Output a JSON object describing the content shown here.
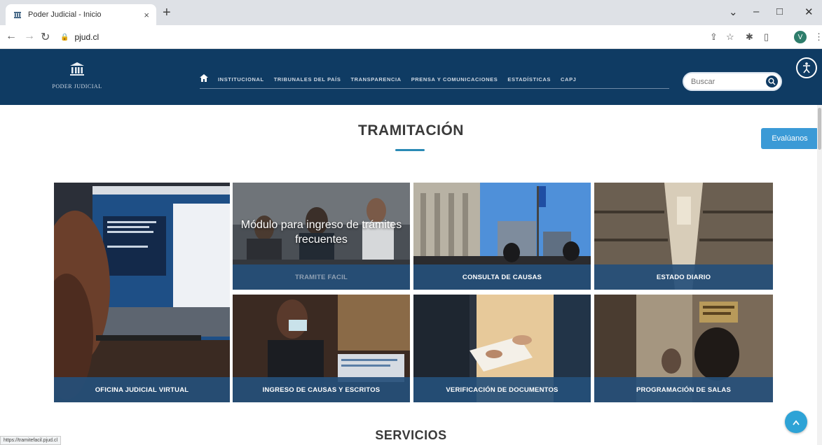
{
  "browser": {
    "tab_title": "Poder Judicial - Inicio",
    "tab_close": "×",
    "new_tab": "+",
    "window_controls": {
      "dropdown": "⌄",
      "minimize": "–",
      "maximize": "□",
      "close": "✕"
    },
    "url": "pjud.cl",
    "profile_initial": "V",
    "status_url": "https://tramitefacil.pjud.cl"
  },
  "header": {
    "logo_text": "PODER JUDICIAL",
    "nav_items": [
      "INSTITUCIONAL",
      "TRIBUNALES DEL PAÍS",
      "TRANSPARENCIA",
      "PRENSA Y COMUNICACIONES",
      "ESTADÍSTICAS",
      "CAPJ"
    ],
    "search_placeholder": "Buscar"
  },
  "main": {
    "section_title": "TRAMITACIÓN",
    "evaluanos_label": "Evalúanos",
    "tiles": [
      {
        "caption": "OFICINA JUDICIAL VIRTUAL",
        "overlay": ""
      },
      {
        "caption": "TRAMITE FACIL",
        "overlay": "Módulo para ingreso de trámites frecuentes"
      },
      {
        "caption": "CONSULTA DE CAUSAS",
        "overlay": ""
      },
      {
        "caption": "ESTADO DIARIO",
        "overlay": ""
      },
      {
        "caption": "INGRESO DE CAUSAS Y ESCRITOS",
        "overlay": ""
      },
      {
        "caption": "VERIFICACIÓN DE DOCUMENTOS",
        "overlay": ""
      },
      {
        "caption": "PROGRAMACIÓN DE SALAS",
        "overlay": ""
      }
    ],
    "next_section_title": "SERVICIOS"
  },
  "colors": {
    "header_bg": "#0f3b63",
    "caption_bg": "#254f79",
    "accent": "#2a8ab5",
    "button": "#3b9ad6"
  }
}
